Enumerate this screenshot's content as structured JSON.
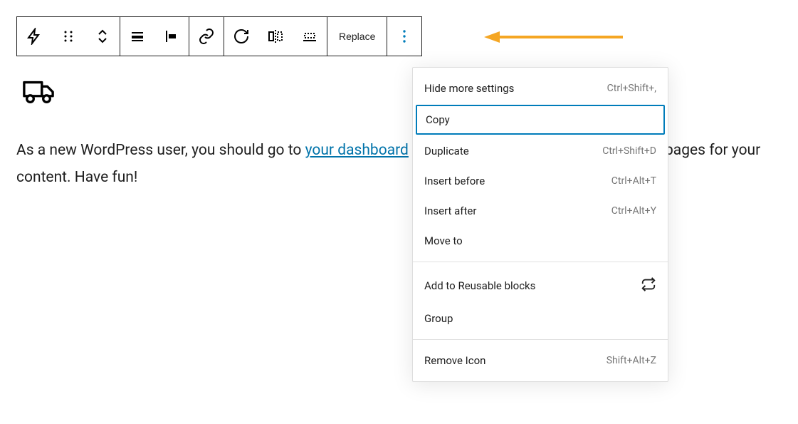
{
  "toolbar": {
    "replace_label": "Replace"
  },
  "paragraph": {
    "text_before": "As a new WordPress user, you should go to ",
    "link_text": "your dashboard",
    "text_after_visible_1": "ew pages for your content. Have fun!"
  },
  "menu": {
    "section1": [
      {
        "label": "Hide more settings",
        "shortcut": "Ctrl+Shift+,"
      },
      {
        "label": "Copy",
        "shortcut": "",
        "selected": true
      },
      {
        "label": "Duplicate",
        "shortcut": "Ctrl+Shift+D"
      },
      {
        "label": "Insert before",
        "shortcut": "Ctrl+Alt+T"
      },
      {
        "label": "Insert after",
        "shortcut": "Ctrl+Alt+Y"
      },
      {
        "label": "Move to",
        "shortcut": ""
      }
    ],
    "section2": [
      {
        "label": "Add to Reusable blocks",
        "icon": "loop-icon"
      },
      {
        "label": "Group"
      }
    ],
    "section3": [
      {
        "label": "Remove Icon",
        "shortcut": "Shift+Alt+Z"
      }
    ]
  }
}
